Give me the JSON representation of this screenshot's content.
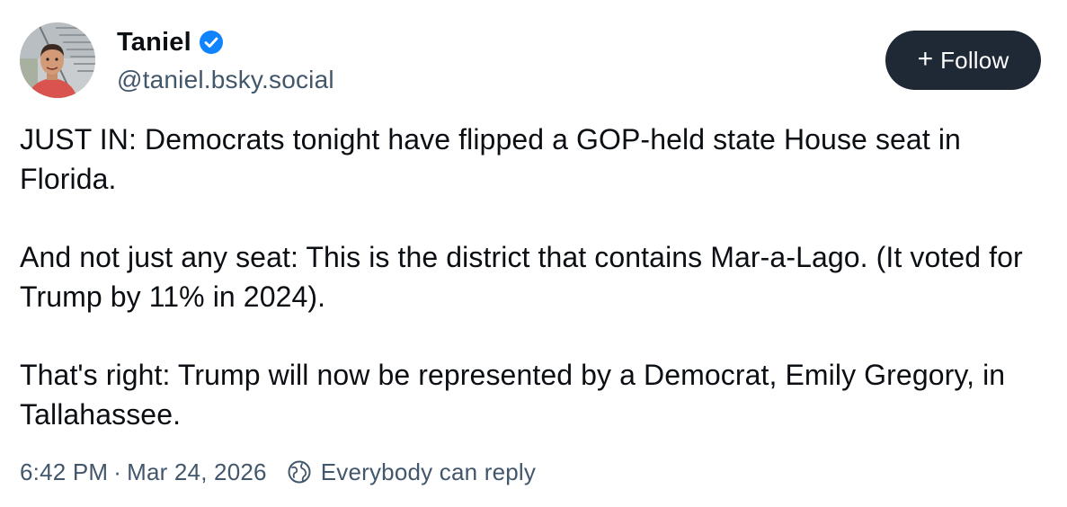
{
  "author": {
    "display_name": "Taniel",
    "handle": "@taniel.bsky.social",
    "verified": true,
    "avatar_icon": "profile-photo"
  },
  "actions": {
    "follow_label": "Follow",
    "follow_icon": "plus-icon"
  },
  "post": {
    "paragraphs": [
      "JUST IN: Democrats tonight have flipped a GOP-held state House seat in Florida.",
      "And not just any seat: This is the district that contains Mar-a-Lago. (It voted for Trump by 11% in 2024).",
      "That's right: Trump will now be represented by a Democrat, Emily Gregory, in Tallahassee."
    ]
  },
  "meta": {
    "time": "6:42 PM",
    "separator": "·",
    "date": "Mar 24, 2026",
    "reply_setting": "Everybody can reply",
    "reply_icon": "globe-icon"
  },
  "colors": {
    "text": "#0b0f14",
    "secondary_text": "#42576c",
    "verified_blue": "#1083fe",
    "follow_button_bg": "#1e2935"
  }
}
